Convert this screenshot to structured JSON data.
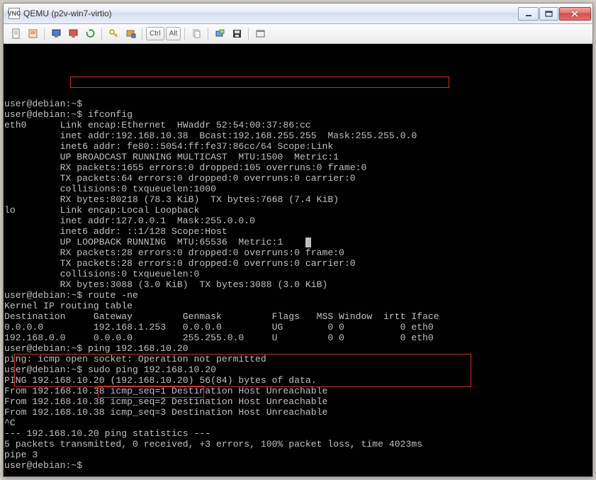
{
  "window": {
    "title": "QEMU (p2v-win7-virtio)",
    "icon_label": "VNC"
  },
  "toolbar": {
    "keys": {
      "ctrl": "Ctrl",
      "alt": "Alt"
    },
    "icons": [
      "page-icon",
      "book-icon",
      "sep",
      "monitor-blue-icon",
      "monitor-red-icon",
      "refresh-icon",
      "sep",
      "key-icon",
      "send-key-icon",
      "sep",
      "ctrl-key",
      "alt-key",
      "sep",
      "copy-icon",
      "sep",
      "fit-icon",
      "save-icon",
      "sep",
      "fullscreen-icon"
    ]
  },
  "terminal": {
    "prompt": "user@debian:~$",
    "lines": [
      "user@debian:~$",
      "user@debian:~$ ifconfig",
      "eth0      Link encap:Ethernet  HWaddr 52:54:00:37:86:cc",
      "          inet addr:192.168.10.38  Bcast:192.168.255.255  Mask:255.255.0.0",
      "          inet6 addr: fe80::5054:ff:fe37:86cc/64 Scope:Link",
      "          UP BROADCAST RUNNING MULTICAST  MTU:1500  Metric:1",
      "          RX packets:1655 errors:0 dropped:105 overruns:0 frame:0",
      "          TX packets:64 errors:0 dropped:0 overruns:0 carrier:0",
      "          collisions:0 txqueuelen:1000",
      "          RX bytes:80218 (78.3 KiB)  TX bytes:7668 (7.4 KiB)",
      "",
      "lo        Link encap:Local Loopback",
      "          inet addr:127.0.0.1  Mask:255.0.0.0",
      "          inet6 addr: ::1/128 Scope:Host",
      "          UP LOOPBACK RUNNING  MTU:65536  Metric:1",
      "          RX packets:28 errors:0 dropped:0 overruns:0 frame:0",
      "          TX packets:28 errors:0 dropped:0 overruns:0 carrier:0",
      "          collisions:0 txqueuelen:0",
      "          RX bytes:3088 (3.0 KiB)  TX bytes:3088 (3.0 KiB)",
      "",
      "user@debian:~$ route -ne",
      "Kernel IP routing table",
      "Destination     Gateway         Genmask         Flags   MSS Window  irtt Iface",
      "0.0.0.0         192.168.1.253   0.0.0.0         UG        0 0          0 eth0",
      "192.168.0.0     0.0.0.0         255.255.0.0     U         0 0          0 eth0",
      "user@debian:~$ ping 192.168.10.20",
      "ping: icmp open socket: Operation not permitted",
      "user@debian:~$ sudo ping 192.168.10.20",
      "PING 192.168.10.20 (192.168.10.20) 56(84) bytes of data.",
      "From 192.168.10.38 icmp_seq=1 Destination Host Unreachable",
      "From 192.168.10.38 icmp_seq=2 Destination Host Unreachable",
      "From 192.168.10.38 icmp_seq=3 Destination Host Unreachable",
      "^C",
      "--- 192.168.10.20 ping statistics ---",
      "5 packets transmitted, 0 received, +3 errors, 100% packet loss, time 4023ms",
      "pipe 3",
      "user@debian:~$"
    ],
    "cursor_line_insert_at": 14
  },
  "network_data": {
    "eth0": {
      "inet": "192.168.10.38",
      "bcast": "192.168.255.255",
      "mask": "255.255.0.0",
      "hwaddr": "52:54:00:37:86:cc"
    },
    "lo": {
      "inet": "127.0.0.1",
      "mask": "255.0.0.0"
    },
    "routes": [
      {
        "dest": "0.0.0.0",
        "gateway": "192.168.1.253",
        "genmask": "0.0.0.0",
        "flags": "UG",
        "iface": "eth0"
      },
      {
        "dest": "192.168.0.0",
        "gateway": "0.0.0.0",
        "genmask": "255.255.0.0",
        "flags": "U",
        "iface": "eth0"
      }
    ],
    "ping_target": "192.168.10.20",
    "ping_source": "192.168.10.38"
  }
}
